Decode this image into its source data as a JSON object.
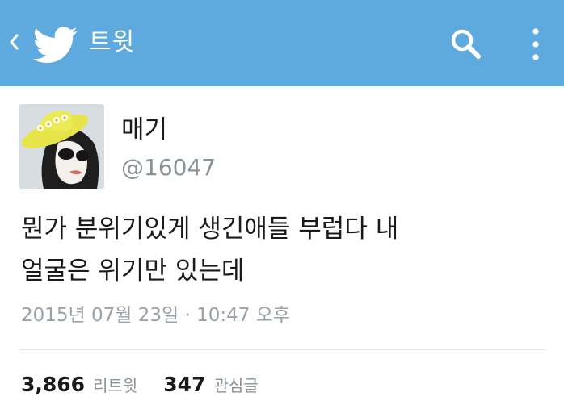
{
  "topbar": {
    "title": "트윗",
    "background": "#5ea9dd",
    "icons": {
      "back": "chevron-left-icon",
      "logo": "twitter-bird-icon",
      "search": "search-icon",
      "menu": "more-vertical-icon"
    }
  },
  "tweet": {
    "author_name": "매기",
    "author_handle": "@16047",
    "text": "뭔가 분위기있게 생긴애들 부럽다 내\n얼굴은 위기만 있는데",
    "timestamp": "2015년 07월 23일 · 10:47 오후"
  },
  "stats": {
    "retweets_count": "3,866",
    "retweets_label": "리트윗",
    "likes_count": "347",
    "likes_label": "관심글"
  }
}
